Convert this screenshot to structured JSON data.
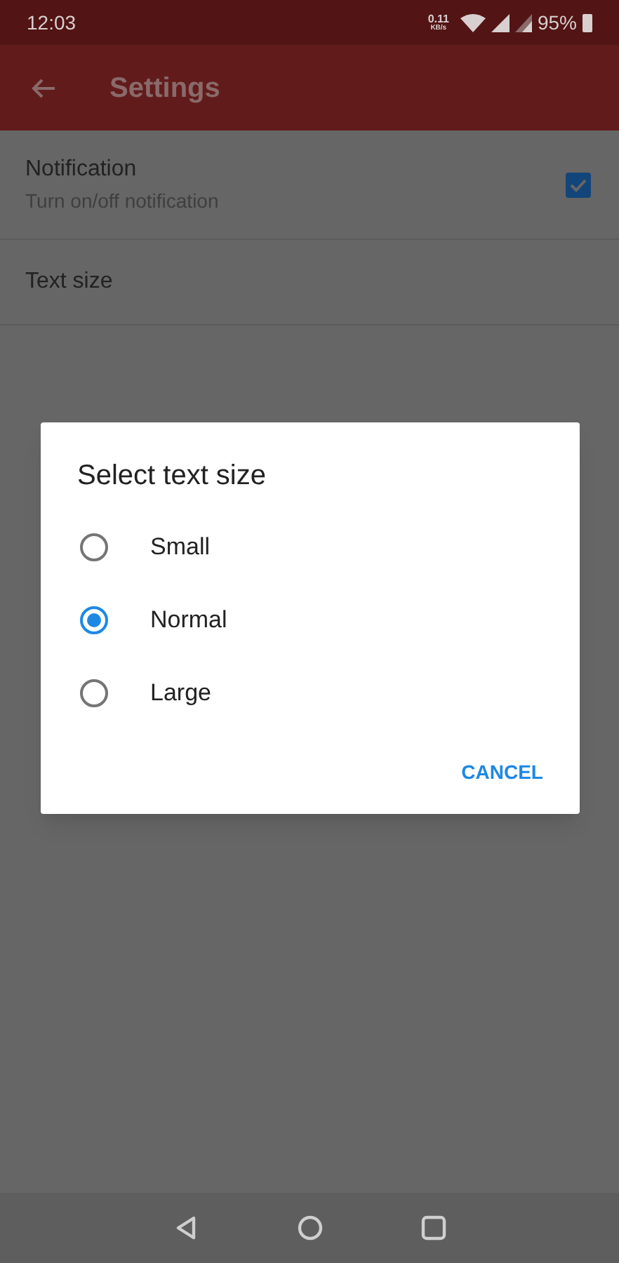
{
  "status_bar": {
    "time": "12:03",
    "net_speed": "0.11",
    "net_unit": "KB/s",
    "battery": "95%"
  },
  "app_bar": {
    "title": "Settings"
  },
  "settings": [
    {
      "kind": "checkbox",
      "title": "Notification",
      "subtitle": "Turn on/off notification",
      "checked": true
    },
    {
      "kind": "plain",
      "title": "Text size"
    }
  ],
  "dialog": {
    "title": "Select text size",
    "options": [
      {
        "label": "Small",
        "selected": false
      },
      {
        "label": "Normal",
        "selected": true
      },
      {
        "label": "Large",
        "selected": false
      }
    ],
    "buttons": [
      "CANCEL"
    ]
  }
}
